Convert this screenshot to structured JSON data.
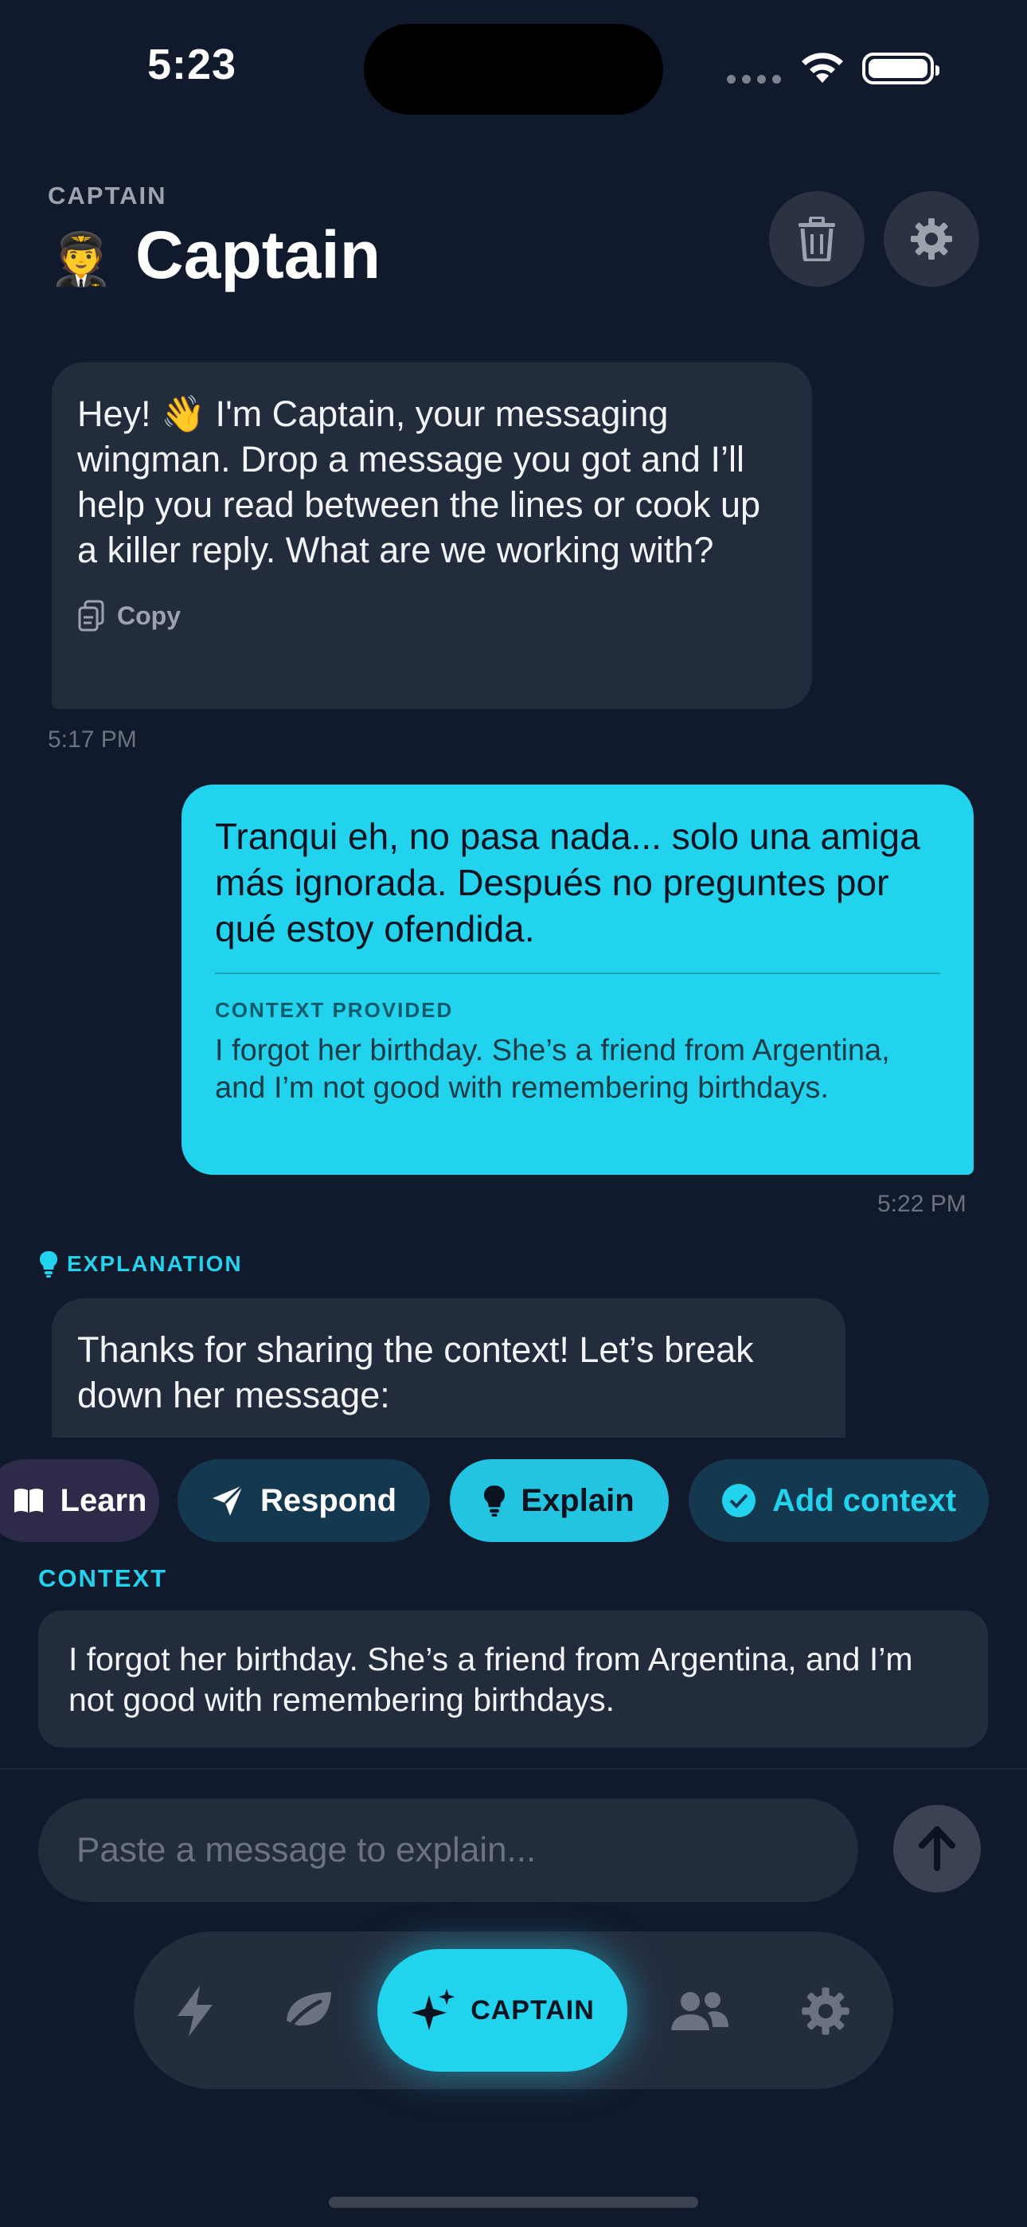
{
  "status_bar": {
    "time": "5:23"
  },
  "header": {
    "kicker": "CAPTAIN",
    "avatar_emoji": "🧑‍✈️",
    "title": "Captain",
    "icons": [
      "trash-icon",
      "gear-icon"
    ]
  },
  "messages": {
    "intro": {
      "text": "Hey! 👋 I'm Captain, your messaging wingman. Drop a message you got and I’ll help you read between the lines or cook up a killer reply. What are we working with?",
      "copy_label": "Copy",
      "time": "5:17 PM"
    },
    "user": {
      "text": "Tranqui eh, no pasa nada... solo una amiga más ignorada. Después no preguntes por qué estoy ofendida.",
      "context_label": "CONTEXT PROVIDED",
      "context_text": "I forgot her birthday. She’s a friend from Argentina, and I’m not good with remembering birthdays.",
      "time": "5:22 PM"
    },
    "explanation": {
      "label": "EXPLANATION",
      "text": "Thanks for sharing the context! Let’s break down her message:"
    }
  },
  "actions": {
    "learn": "Learn",
    "respond": "Respond",
    "explain": "Explain",
    "add_context": "Add context"
  },
  "context_panel": {
    "label": "CONTEXT",
    "text": "I forgot her birthday. She’s a friend from Argentina, and I’m not good with remembering birthdays."
  },
  "composer": {
    "placeholder": "Paste a message to explain..."
  },
  "tab_bar": {
    "items": [
      "bolt-icon",
      "leaf-icon",
      "sparkles-icon",
      "users-icon",
      "gear-icon"
    ],
    "active_label": "CAPTAIN"
  },
  "colors": {
    "background": "#111a2c",
    "accent": "#22d3ee",
    "bubble": "#232c3d"
  }
}
